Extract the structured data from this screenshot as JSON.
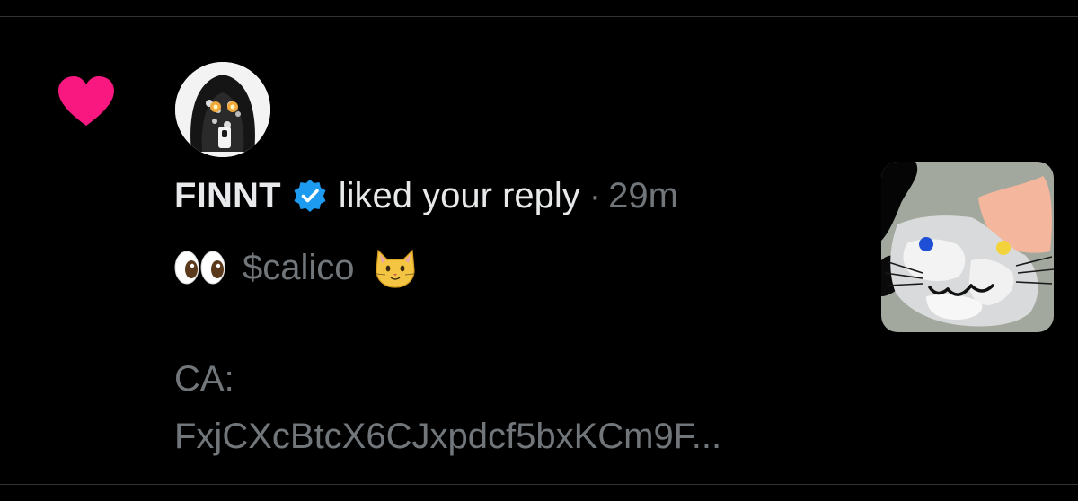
{
  "notification": {
    "type_icon": "heart-icon",
    "avatar_icon": "user-avatar",
    "user_name": "FINNT",
    "verified_icon": "verified-badge-icon",
    "action": "liked your reply",
    "separator": "·",
    "timestamp": "29m",
    "tweet": {
      "leading_emoji": "eyes-emoji",
      "cashtag": "$calico",
      "trailing_emoji": "cat-face-emoji",
      "ca_label": "CA:",
      "ca_address": "FxjCXcBtcX6CJxpdcf5bxKCm9F..."
    },
    "thumbnail_icon": "calico-cat-image"
  },
  "colors": {
    "background": "#000000",
    "heart": "#f91880",
    "verified": "#1d9bf0",
    "primary_text": "#e7e9ea",
    "secondary_text": "#71767b"
  }
}
